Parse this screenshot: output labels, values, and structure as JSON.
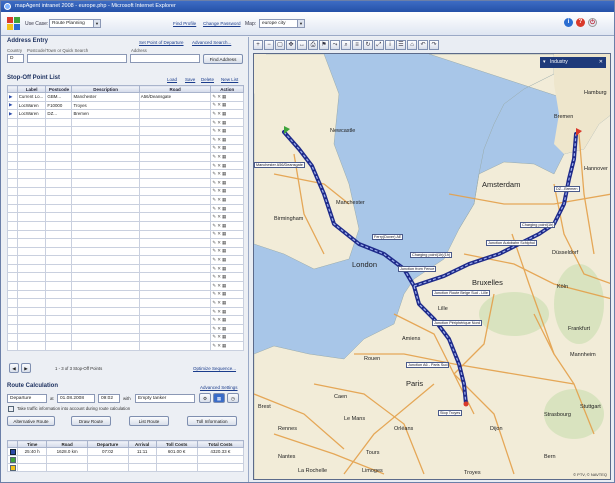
{
  "window": {
    "title": "mapAgent intranet 2008 - europe.php - Microsoft Internet Explorer"
  },
  "toolbar": {
    "usecase_label": "Use Case:",
    "usecase_value": "Route Planning",
    "link_find_profile": "Find Profile",
    "link_change_password": "Change Password",
    "map_label": "Map:",
    "map_value": "europe city",
    "colors": {
      "logo_red": "#d93a2b",
      "logo_green": "#3ea43b",
      "logo_yellow": "#f2c21a",
      "logo_blue": "#2b6dd1"
    }
  },
  "address": {
    "title": "Address Entry",
    "link_set_departure": "Set Point of Departure",
    "link_advanced_search": "Advanced Search...",
    "col_country": "Country",
    "col_postcode": "Postcode/Town or Quick Search",
    "col_address": "Address",
    "country_value": "D",
    "find_button": "Find Address"
  },
  "stops": {
    "title": "Stop-Off Point List",
    "link_load": "Load",
    "link_save": "Save",
    "link_delete": "Delete",
    "link_new_list": "New List",
    "headers": [
      "",
      "Label",
      "Postcode",
      "Description",
      "Road",
      "Action"
    ],
    "rows": [
      {
        "label": "Current Lo...",
        "postcode": "GBM...",
        "description": "Manchester",
        "road": "A56/Deansgate"
      },
      {
        "label": "LocWaren",
        "postcode": "F10000",
        "description": "Troyes",
        "road": ""
      },
      {
        "label": "LocWaren",
        "postcode": "DZ...",
        "description": "Bremen",
        "road": ""
      }
    ],
    "empty_rows": 27,
    "pager_text": "1 - 3    of  3   Stop-Off Points",
    "link_optimize": "Optimize Sequence..."
  },
  "route": {
    "title": "Route Calculation",
    "link_advanced": "Advanced Settings",
    "mode_value": "Departure",
    "at_label": "at",
    "date_value": "01.08.2008",
    "time_value": "09:02",
    "with_label": "with",
    "vehicle_value": "Empty tanker",
    "traffic_label": "Take traffic information into account during route calculation",
    "btn_alternative": "Alternative Route",
    "btn_draw": "Draw Route",
    "btn_list": "List Route",
    "btn_toll": "Toll Information",
    "headers": [
      "",
      "Time",
      "Road",
      "Departure",
      "Arrival",
      "Toll Costs",
      "Total Costs"
    ],
    "rows": [
      {
        "time": "25:40 h",
        "road": "1628.0 km",
        "departure": "07:02",
        "arrival": "11:11",
        "toll": "601.00 €",
        "total": "4320.33 €"
      }
    ]
  },
  "map": {
    "industry_label": "Industry",
    "copyright": "© PTV, © NAVTEQ",
    "labels": {
      "newcastle": "Newcastle",
      "manchester": "Manchester",
      "birmingham": "Birmingham",
      "london": "London",
      "amsterdam": "Amsterdam",
      "bremen": "Bremen",
      "hamburg": "Hamburg",
      "hannover": "Hannover",
      "dusseldorf": "Düsseldorf",
      "koln": "Köln",
      "bruxelles": "Bruxelles",
      "lille": "Lille",
      "amiens": "Amiens",
      "rouen": "Rouen",
      "paris": "Paris",
      "troyes": "Troyes",
      "frankfurt": "Frankfurt",
      "mannheim": "Mannheim",
      "stuttgart": "Stuttgart",
      "strasbourg": "Strasbourg",
      "nantes": "Nantes",
      "le_mans": "Le Mans",
      "tours": "Tours",
      "orleans": "Orléans",
      "dijon": "Dijon",
      "bern": "Bern",
      "rennes": "Rennes",
      "la_rochelle": "La Rochelle",
      "limoges": "Limoges",
      "caen": "Caen",
      "brest": "Brest"
    },
    "callouts": {
      "manchester": "Manchester  A56/Deansgate",
      "bremen": "DZ...Bremen",
      "ferry": "Ferry(Dover) AE",
      "charging1": "Charging point(1h)(1h)",
      "charging2": "Charging point(1h)",
      "border1": "Junction from Fence",
      "border2": "Junction Autobahn Schiphol",
      "bruxelles": "Junction Route Belge Sud - Lille",
      "paris_ring": "Junction Périphérique Nord",
      "paris_south": "Junction A6 - Paris Sud",
      "troyes": "Stop Troyes"
    }
  }
}
